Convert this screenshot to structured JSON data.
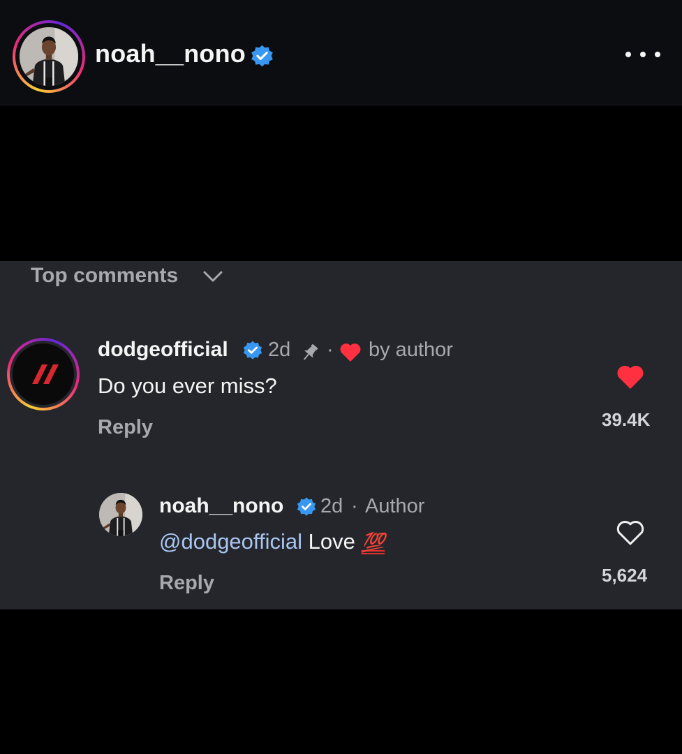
{
  "header": {
    "username": "noah__nono",
    "avatar_icon": "profile-photo",
    "verified_icon": "verified-badge-icon",
    "more_icon": "more-options-icon"
  },
  "comments_section": {
    "sort_label": "Top comments",
    "sort_icon": "chevron-down-icon"
  },
  "comments": [
    {
      "username": "dodgeofficial",
      "time": "2d",
      "pin_icon": "pin-icon",
      "separator": "·",
      "liked_by_author_icon": "heart-icon",
      "liked_by_label": "by author",
      "text": "Do you ever miss?",
      "reply_label": "Reply",
      "like_count": "39.4K",
      "liked": true
    },
    {
      "username": "noah__nono",
      "time": "2d",
      "separator": "·",
      "author_label": "Author",
      "mention": "@dodgeofficial",
      "text": "Love",
      "emoji": "💯",
      "reply_label": "Reply",
      "like_count": "5,624",
      "liked": false
    }
  ],
  "colors": {
    "background": "#000000",
    "header_bg": "#0c0d10",
    "panel_bg": "#25262b",
    "verified_blue": "#3897f0",
    "like_red": "#ff3040",
    "mention_blue": "#a9c6f2",
    "muted_text": "#a8a9ae"
  }
}
